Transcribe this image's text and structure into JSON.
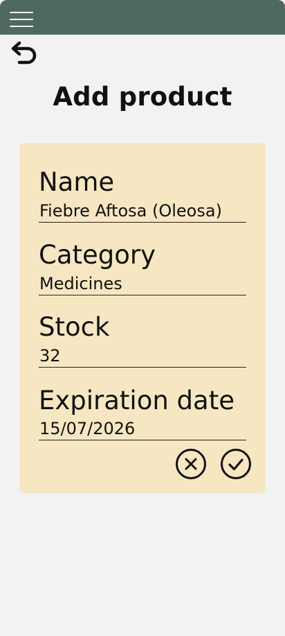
{
  "header": {
    "title": "Add product"
  },
  "form": {
    "fields": [
      {
        "label": "Name",
        "value": "Fiebre Aftosa (Oleosa)"
      },
      {
        "label": "Category",
        "value": "Medicines"
      },
      {
        "label": "Stock",
        "value": "32"
      },
      {
        "label": "Expiration date",
        "value": "15/07/2026"
      }
    ]
  },
  "colors": {
    "topbar": "#4e6a5f",
    "background": "#f2f2f2",
    "card": "#f6e7c2",
    "text": "#111111"
  },
  "icons": {
    "menu": "hamburger-menu-icon",
    "back": "undo-arrow-icon",
    "cancel": "circle-x-icon",
    "confirm": "circle-check-icon"
  }
}
